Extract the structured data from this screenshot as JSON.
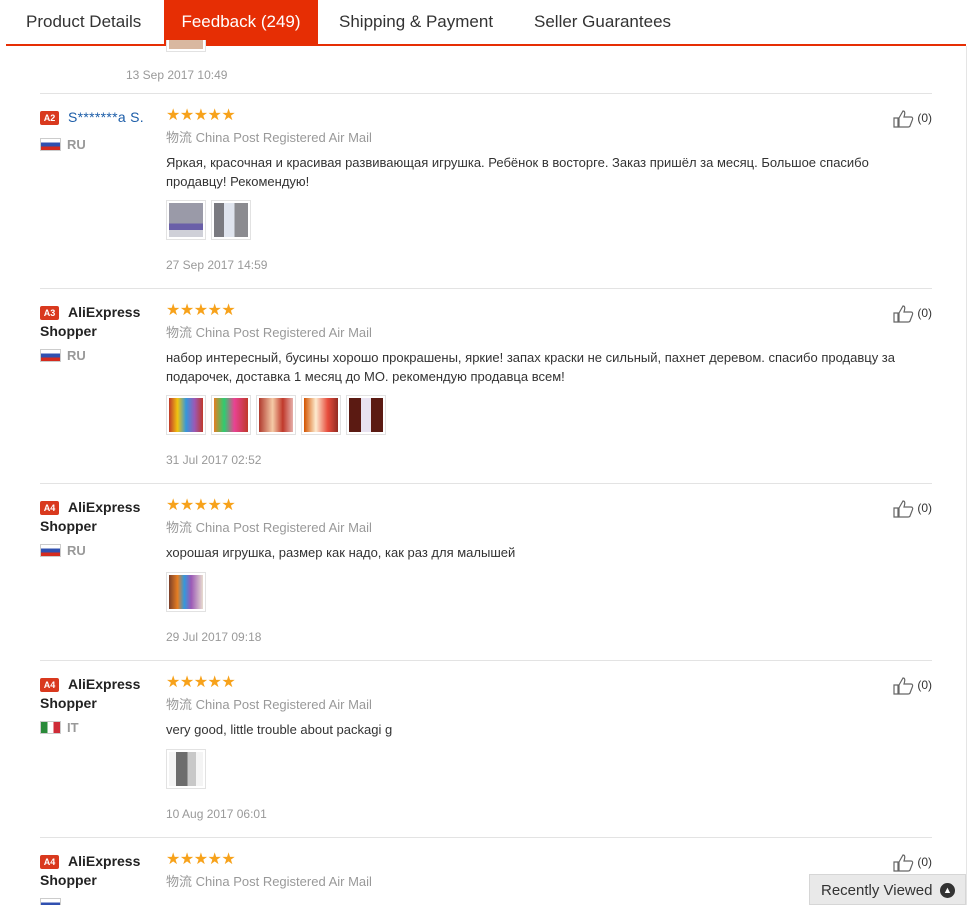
{
  "tabs": [
    {
      "label": "Product Details"
    },
    {
      "label": "Feedback (249)"
    },
    {
      "label": "Shipping & Payment"
    },
    {
      "label": "Seller Guarantees"
    }
  ],
  "top_partial": {
    "date": "13 Sep 2017 10:49"
  },
  "reviews": [
    {
      "badge": "A2",
      "name": "S*******a S.",
      "country": "RU",
      "stars": "★★★★★",
      "shipping": "物流 China Post Registered Air Mail",
      "text": "Яркая, красочная и красивая развивающая игрушка. Ребёнок в восторге. Заказ пришёл за месяц. Большое спасибо продавцу! Рекомендую!",
      "date": "27 Sep 2017 14:59",
      "likes": "(0)"
    },
    {
      "badge": "A3",
      "name": "AliExpress Shopper",
      "country": "RU",
      "stars": "★★★★★",
      "shipping": "物流 China Post Registered Air Mail",
      "text": "набор интересный, бусины хорошо прокрашены, яркие! запах краски не сильный, пахнет деревом. спасибо продавцу за подарочек, доставка 1 месяц до МО. рекомендую продавца всем!",
      "date": "31 Jul 2017 02:52",
      "likes": "(0)"
    },
    {
      "badge": "A4",
      "name": "AliExpress Shopper",
      "country": "RU",
      "stars": "★★★★★",
      "shipping": "物流 China Post Registered Air Mail",
      "text": "хорошая игрушка, размер как надо, как раз для малышей",
      "date": "29 Jul 2017 09:18",
      "likes": "(0)"
    },
    {
      "badge": "A4",
      "name": "AliExpress Shopper",
      "country": "IT",
      "stars": "★★★★★",
      "shipping": "物流 China Post Registered Air Mail",
      "text": "very good, little trouble about packagi g",
      "date": "10 Aug 2017 06:01",
      "likes": "(0)"
    },
    {
      "badge": "A4",
      "name": "AliExpress Shopper",
      "country": "RU",
      "stars": "★★★★★",
      "shipping": "物流 China Post Registered Air Mail",
      "likes": "(0)"
    }
  ],
  "recently_viewed": {
    "label": "Recently Viewed",
    "icon": "chevron-up-icon"
  },
  "colors": {
    "accent": "#e62e04",
    "star": "#f7a21b",
    "badge": "#d9391e"
  }
}
